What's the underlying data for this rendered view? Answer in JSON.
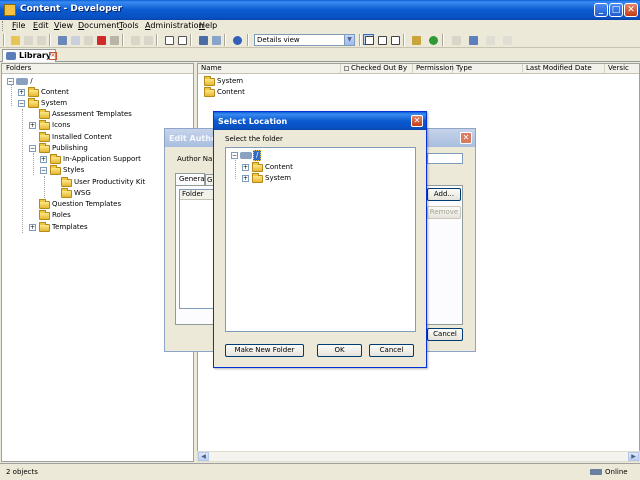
{
  "window": {
    "title": "Content - Developer",
    "min": "_",
    "max": "□",
    "close": "✕"
  },
  "menubar": {
    "items": [
      "File",
      "Edit",
      "View",
      "Document",
      "Tools",
      "Administration",
      "Help"
    ],
    "accelerators": [
      "F",
      "E",
      "V",
      "D",
      "T",
      "A",
      "H"
    ]
  },
  "toolbar": {
    "view_select": "Details view",
    "view_select_arrow": "▼"
  },
  "tabs": {
    "library": "Library"
  },
  "left_pane": {
    "header": "Folders",
    "tree": [
      {
        "label": "/",
        "depth": 0,
        "expander": "−"
      },
      {
        "label": "Content",
        "depth": 1,
        "expander": "+"
      },
      {
        "label": "System",
        "depth": 1,
        "expander": "−"
      },
      {
        "label": "Assessment Templates",
        "depth": 2,
        "expander": ""
      },
      {
        "label": "Icons",
        "depth": 2,
        "expander": "+"
      },
      {
        "label": "Installed Content",
        "depth": 2,
        "expander": ""
      },
      {
        "label": "Publishing",
        "depth": 2,
        "expander": "−"
      },
      {
        "label": "In-Application Support",
        "depth": 3,
        "expander": "+"
      },
      {
        "label": "Styles",
        "depth": 3,
        "expander": "−"
      },
      {
        "label": "User Productivity Kit",
        "depth": 4,
        "expander": ""
      },
      {
        "label": "WSG",
        "depth": 4,
        "expander": ""
      },
      {
        "label": "Question Templates",
        "depth": 2,
        "expander": ""
      },
      {
        "label": "Roles",
        "depth": 2,
        "expander": ""
      },
      {
        "label": "Templates",
        "depth": 2,
        "expander": "+"
      }
    ]
  },
  "right_pane": {
    "columns": [
      "Name",
      "Checked Out By",
      "Permission",
      "Type",
      "Last Modified Date",
      "Versic"
    ],
    "rows": [
      "System",
      "Content"
    ]
  },
  "status": {
    "left": "2 objects",
    "right": "Online"
  },
  "bg_dialog": {
    "title": "Edit Author",
    "author_label": "Author Nam",
    "tab_general": "General",
    "tab_other": "G",
    "folder_col": "Folder",
    "add_button": "Add...",
    "remove_button": "Remove",
    "cancel_button": "Cancel",
    "close": "✕"
  },
  "dialog": {
    "title": "Select Location",
    "close": "✕",
    "label": "Select the folder",
    "tree": [
      {
        "label": "/",
        "expander": "−"
      },
      {
        "label": "Content",
        "expander": "+"
      },
      {
        "label": "System",
        "expander": "+"
      }
    ],
    "make_new_folder": "Make New Folder",
    "ok": "OK",
    "cancel": "Cancel"
  },
  "colors": {
    "titlebar_blue": "#0a5ad0",
    "selection_blue": "#316ac5",
    "dialog_face": "#ece9d8"
  }
}
